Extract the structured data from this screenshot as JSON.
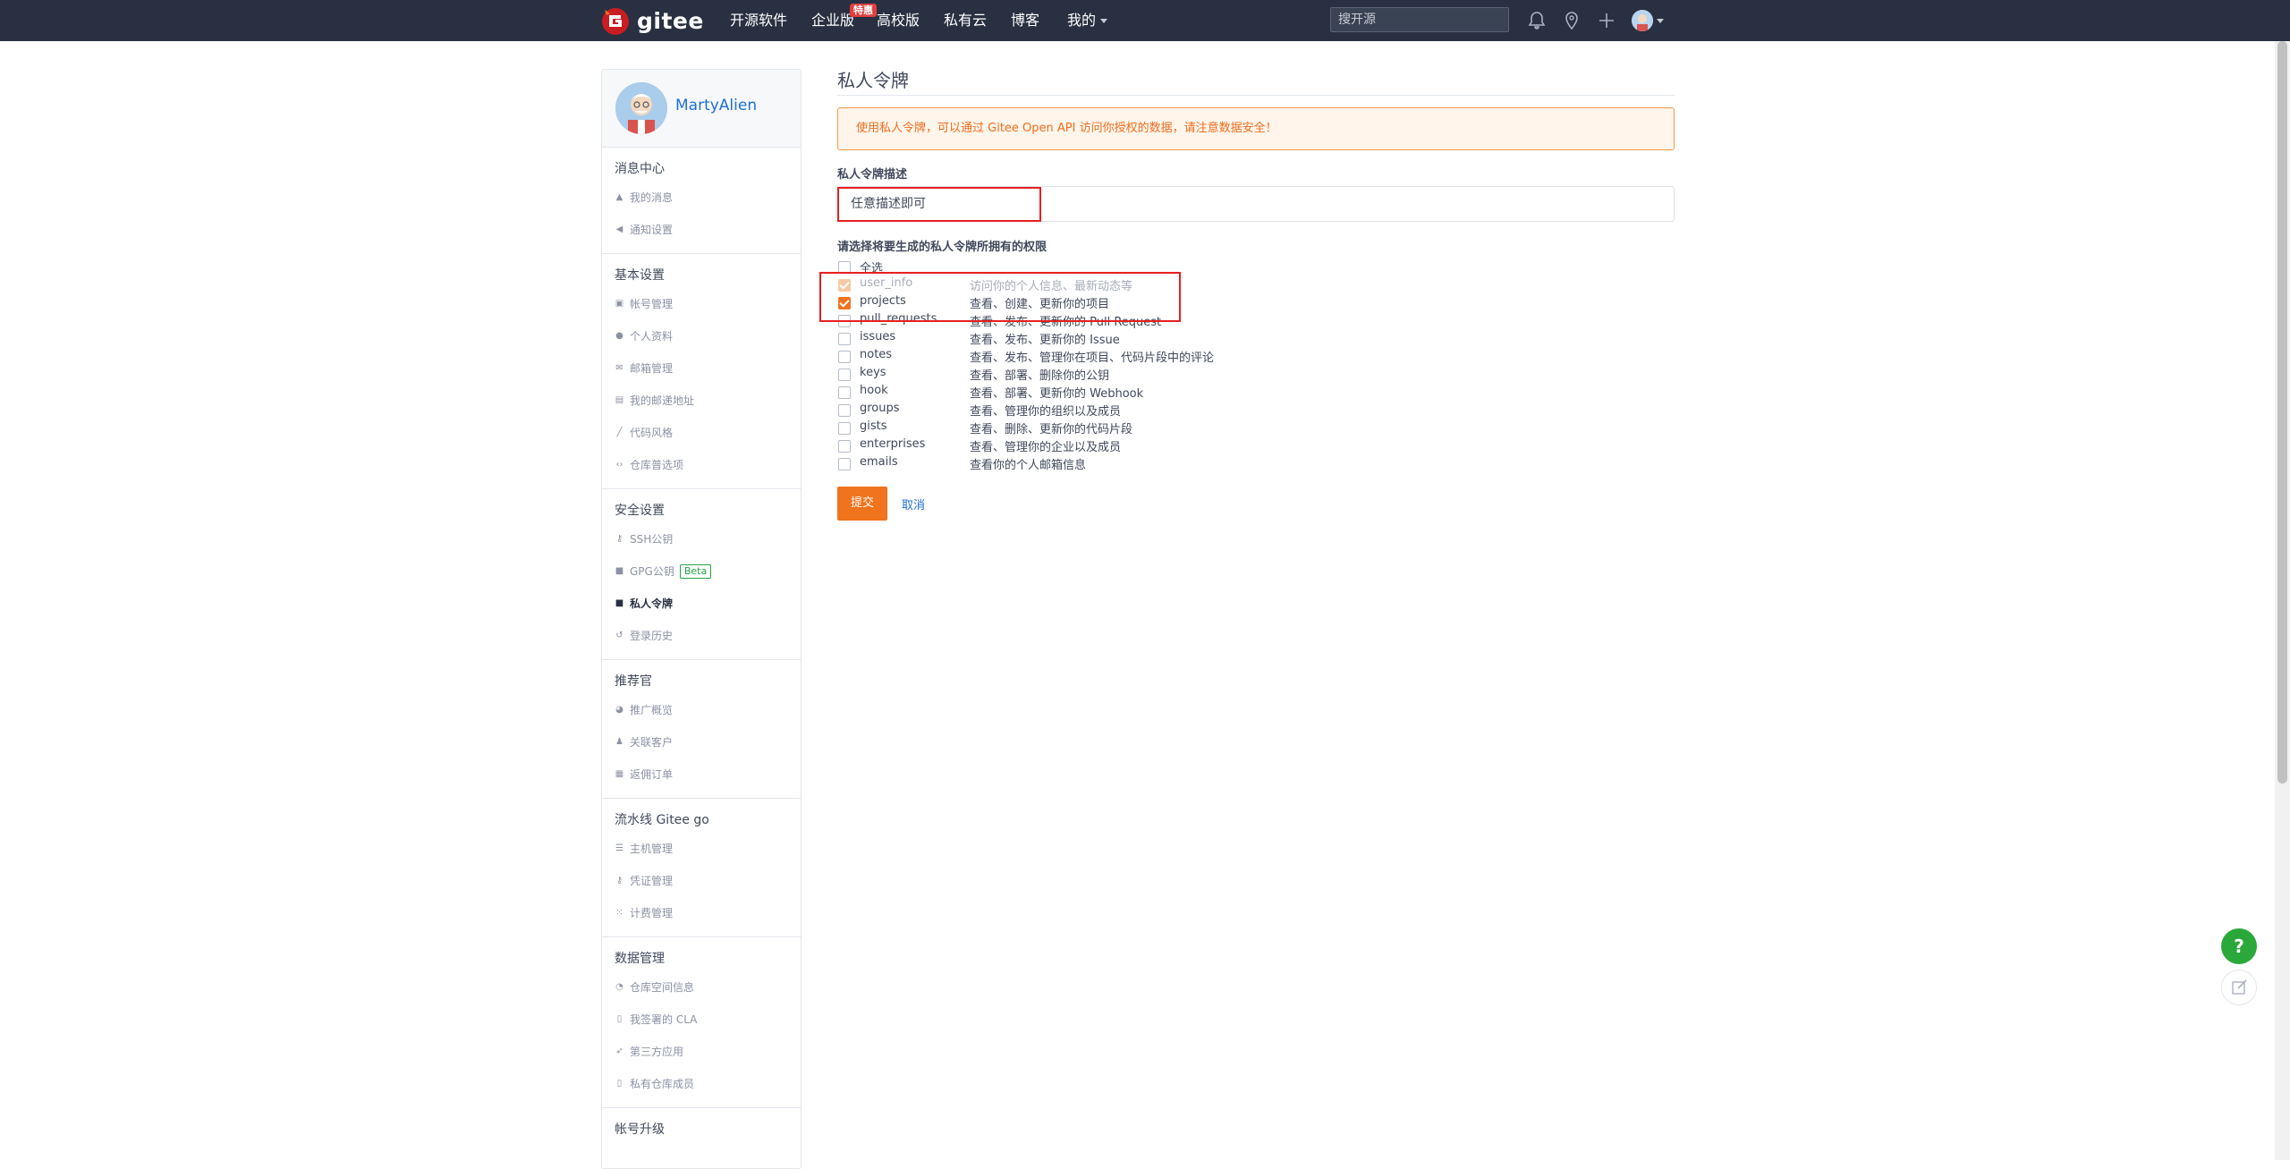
{
  "header": {
    "brand": "gitee",
    "nav": [
      "开源软件",
      "企业版",
      "高校版",
      "私有云",
      "博客",
      "我的"
    ],
    "hot_badge": "特惠",
    "search_placeholder": "搜开源"
  },
  "colors": {
    "topbar": "#283041",
    "accent": "#f0731d",
    "link": "#1e6fd9",
    "highlight_box": "#e81f1f"
  },
  "sidebar": {
    "username": "MartyAlien",
    "sections": [
      {
        "title": "消息中心",
        "items": [
          "我的消息",
          "通知设置"
        ]
      },
      {
        "title": "基本设置",
        "items": [
          "帐号管理",
          "个人资料",
          "邮箱管理",
          "我的邮递地址",
          "代码风格",
          "仓库普选项"
        ]
      },
      {
        "title": "安全设置",
        "items": [
          "SSH公钥",
          "GPG公钥",
          "私人令牌",
          "登录历史"
        ],
        "beta_label": "Beta"
      },
      {
        "title": "推荐官",
        "items": [
          "推广概览",
          "关联客户",
          "返佣订单"
        ]
      },
      {
        "title": "流水线 Gitee go",
        "items": [
          "主机管理",
          "凭证管理",
          "计费管理"
        ]
      },
      {
        "title": "数据管理",
        "items": [
          "仓库空间信息",
          "我签署的 CLA",
          "第三方应用",
          "私有仓库成员"
        ]
      },
      {
        "title": "帐号升级",
        "items": []
      }
    ]
  },
  "main": {
    "title": "私人令牌",
    "notice": "使用私人令牌，可以通过 Gitee Open API 访问你授权的数据，请注意数据安全！",
    "desc_label": "私人令牌描述",
    "desc_value": "任意描述即可",
    "scopes_label": "请选择将要生成的私人令牌所拥有的权限",
    "select_all": "全选",
    "scopes": [
      {
        "name": "user_info",
        "desc": "访问你的个人信息、最新动态等",
        "checked": true,
        "disabled": true
      },
      {
        "name": "projects",
        "desc": "查看、创建、更新你的项目",
        "checked": true,
        "disabled": false
      },
      {
        "name": "pull_requests",
        "desc": "查看、发布、更新你的 Pull Request",
        "checked": false,
        "disabled": false
      },
      {
        "name": "issues",
        "desc": "查看、发布、更新你的 Issue",
        "checked": false,
        "disabled": false
      },
      {
        "name": "notes",
        "desc": "查看、发布、管理你在项目、代码片段中的评论",
        "checked": false,
        "disabled": false
      },
      {
        "name": "keys",
        "desc": "查看、部署、删除你的公钥",
        "checked": false,
        "disabled": false
      },
      {
        "name": "hook",
        "desc": "查看、部署、更新你的 Webhook",
        "checked": false,
        "disabled": false
      },
      {
        "name": "groups",
        "desc": "查看、管理你的组织以及成员",
        "checked": false,
        "disabled": false
      },
      {
        "name": "gists",
        "desc": "查看、删除、更新你的代码片段",
        "checked": false,
        "disabled": false
      },
      {
        "name": "enterprises",
        "desc": "查看、管理你的企业以及成员",
        "checked": false,
        "disabled": false
      },
      {
        "name": "emails",
        "desc": "查看你的个人邮箱信息",
        "checked": false,
        "disabled": false
      }
    ],
    "submit_label": "提交",
    "cancel_label": "取消"
  },
  "floating": {
    "help_label": "?"
  }
}
